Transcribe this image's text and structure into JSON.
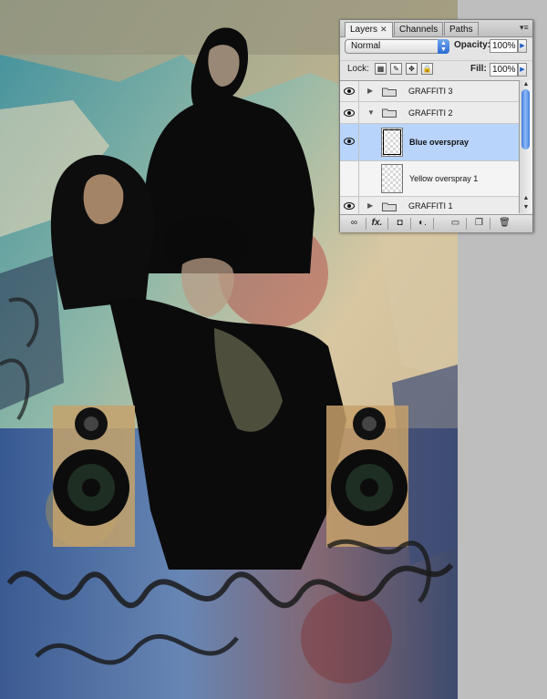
{
  "layers_panel": {
    "tabs": [
      {
        "label": "Layers",
        "close": "✕",
        "active": true
      },
      {
        "label": "Channels",
        "active": false
      },
      {
        "label": "Paths",
        "active": false
      }
    ],
    "blend_mode": "Normal",
    "opacity_label": "Opacity:",
    "opacity_value": "100%",
    "lock_label": "Lock:",
    "fill_label": "Fill:",
    "fill_value": "100%",
    "layers": [
      {
        "name": "GRAFFITI 3",
        "type": "group",
        "expanded": false,
        "visible": true,
        "selected": false
      },
      {
        "name": "GRAFFITI 2",
        "type": "group",
        "expanded": true,
        "visible": true,
        "selected": false
      },
      {
        "name": "Blue overspray",
        "type": "layer",
        "visible": true,
        "selected": true
      },
      {
        "name": "Yellow overspray 1",
        "type": "layer",
        "visible": false,
        "selected": false
      },
      {
        "name": "GRAFFITI 1",
        "type": "group",
        "expanded": false,
        "visible": true,
        "selected": false
      }
    ],
    "bottom_icons": [
      "link-icon",
      "fx-icon",
      "mask-icon",
      "adjustment-icon",
      "group-icon",
      "new-layer-icon",
      "trash-icon"
    ],
    "bottom_glyphs": {
      "link": "∞",
      "fx": "fx.",
      "mask": "◘",
      "adjust": "◐.",
      "group": "▭",
      "new": "❐",
      "trash": "🗑"
    },
    "accent_color": "#3f7ee0",
    "selected_row_color": "#b9d4fb"
  }
}
